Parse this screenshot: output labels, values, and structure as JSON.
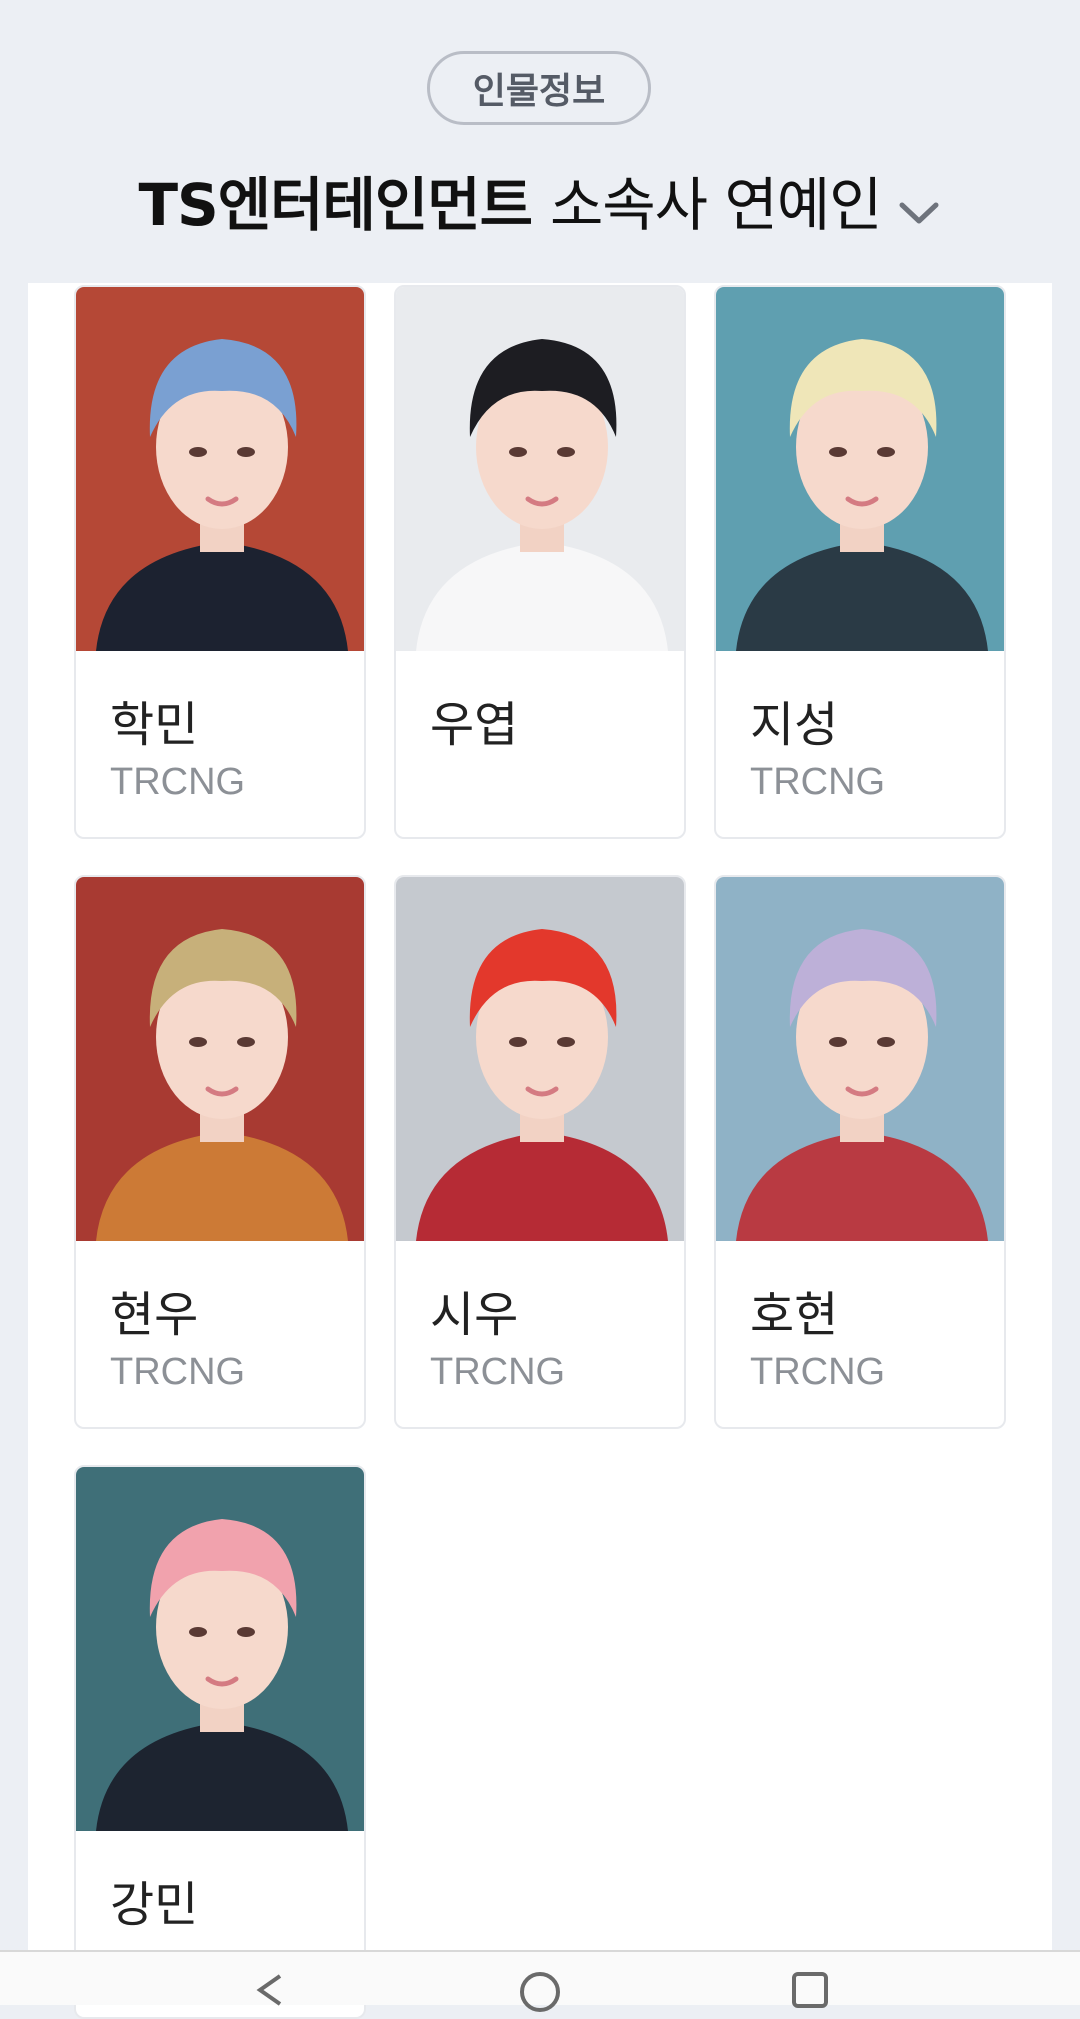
{
  "header": {
    "pill_label": "인물정보",
    "title_strong": "TS엔터테인먼트",
    "title_rest": "소속사 연예인"
  },
  "people": [
    {
      "name": "학민",
      "group": "TRCNG",
      "hair": "#7aa0d2",
      "bg": "#b54836",
      "shirt": "#1c2230"
    },
    {
      "name": "우엽",
      "group": "",
      "hair": "#1d1d22",
      "bg": "#e9ebee",
      "shirt": "#f7f7f8"
    },
    {
      "name": "지성",
      "group": "TRCNG",
      "hair": "#efe6b8",
      "bg": "#5f9fb0",
      "shirt": "#2a3a45"
    },
    {
      "name": "현우",
      "group": "TRCNG",
      "hair": "#c7b07a",
      "bg": "#a83a32",
      "shirt": "#cc7a36"
    },
    {
      "name": "시우",
      "group": "TRCNG",
      "hair": "#e3382c",
      "bg": "#c5c9cf",
      "shirt": "#b62b35"
    },
    {
      "name": "호현",
      "group": "TRCNG",
      "hair": "#bdb0d8",
      "bg": "#8fb2c6",
      "shirt": "#b93a42"
    },
    {
      "name": "강민",
      "group": "",
      "hair": "#f1a2ad",
      "bg": "#3f6f78",
      "shirt": "#1d2430"
    }
  ],
  "colors": {
    "page_bg": "#eceff4",
    "panel_bg": "#ffffff",
    "secondary_text": "#8c9096"
  },
  "icons": [
    "chevron-down-icon",
    "back-icon",
    "home-icon",
    "recent-apps-icon"
  ]
}
